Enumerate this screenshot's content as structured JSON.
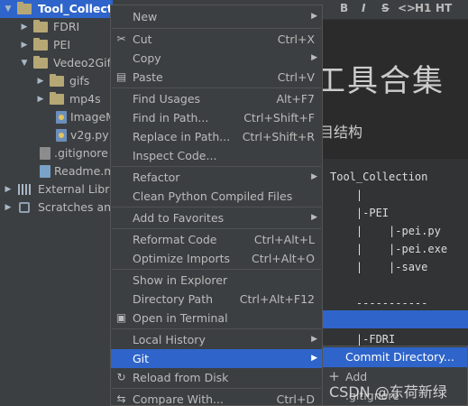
{
  "project_tree": {
    "items": [
      {
        "label": "Tool_Collectio",
        "icon": "folder-icon",
        "expanded": true,
        "selected": true
      },
      {
        "label": "FDRI",
        "icon": "folder-icon"
      },
      {
        "label": "PEI",
        "icon": "folder-icon"
      },
      {
        "label": "Vedeo2Gif",
        "icon": "folder-icon",
        "expanded": true
      },
      {
        "label": "gifs",
        "icon": "folder-icon"
      },
      {
        "label": "mp4s",
        "icon": "folder-icon"
      },
      {
        "label": "ImageM",
        "icon": "python-file-icon"
      },
      {
        "label": "v2g.py",
        "icon": "python-file-icon"
      },
      {
        "label": ".gitignore",
        "icon": "gitignore-file-icon"
      },
      {
        "label": "Readme.m",
        "icon": "markdown-file-icon"
      },
      {
        "label": "External Libra",
        "icon": "libraries-icon"
      },
      {
        "label": "Scratches and",
        "icon": "scratches-icon"
      }
    ]
  },
  "editor": {
    "toolbar": {
      "bold": "B",
      "italic": "I",
      "strike": "S",
      "code": "<>",
      "h1": "H1",
      "ht": "HT"
    },
    "heading": "工具合集",
    "subheading": "目结构",
    "code_lines": [
      "Tool_Collection",
      "    |",
      "    |-PEI",
      "    |    |-pei.py",
      "    |    |-pei.exe",
      "    |    |-save",
      "",
      "    -----------",
      "",
      "    |-FDRI"
    ]
  },
  "context_menu": {
    "items": [
      {
        "label": "New",
        "submenu": true
      },
      {
        "label": "Cut",
        "shortcut": "Ctrl+X",
        "icon": "cut-icon"
      },
      {
        "label": "Copy",
        "submenu": true
      },
      {
        "label": "Paste",
        "shortcut": "Ctrl+V",
        "icon": "paste-icon"
      },
      {
        "label": "Find Usages",
        "shortcut": "Alt+F7"
      },
      {
        "label": "Find in Path...",
        "shortcut": "Ctrl+Shift+F"
      },
      {
        "label": "Replace in Path...",
        "shortcut": "Ctrl+Shift+R"
      },
      {
        "label": "Inspect Code..."
      },
      {
        "label": "Refactor",
        "submenu": true
      },
      {
        "label": "Clean Python Compiled Files"
      },
      {
        "label": "Add to Favorites",
        "submenu": true
      },
      {
        "label": "Reformat Code",
        "shortcut": "Ctrl+Alt+L"
      },
      {
        "label": "Optimize Imports",
        "shortcut": "Ctrl+Alt+O"
      },
      {
        "label": "Show in Explorer"
      },
      {
        "label": "Directory Path",
        "shortcut": "Ctrl+Alt+F12"
      },
      {
        "label": "Open in Terminal",
        "icon": "terminal-icon"
      },
      {
        "label": "Local History",
        "submenu": true
      },
      {
        "label": "Git",
        "submenu": true,
        "highlighted": true
      },
      {
        "label": "Reload from Disk",
        "icon": "reload-icon"
      },
      {
        "label": "Compare With...",
        "shortcut": "Ctrl+D",
        "icon": "compare-icon"
      }
    ]
  },
  "git_submenu": {
    "items": [
      {
        "label": "Commit Directory...",
        "highlighted": true
      },
      {
        "label": "Add",
        "icon": "plus-icon"
      },
      {
        "label": ".gitignore"
      }
    ]
  },
  "watermark": "CSDN @东荷新绿",
  "colors": {
    "selection": "#2f65ca",
    "panel": "#3c3f41",
    "editor_bg": "#2b2b2b",
    "folder": "#b6a875"
  }
}
